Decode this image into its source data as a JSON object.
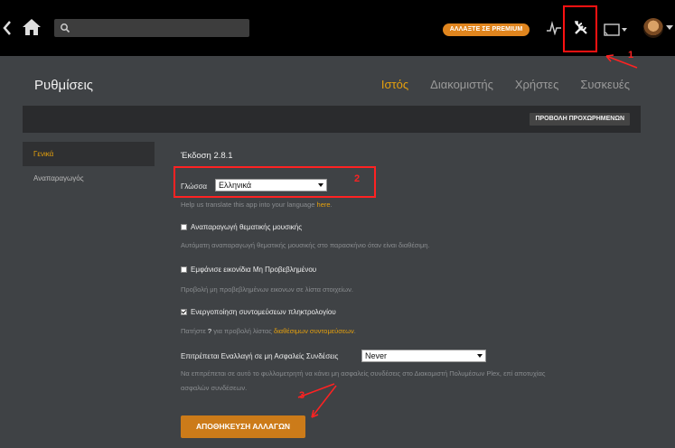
{
  "topbar": {
    "premium_label": "ΑΛΛΑΞΤΕ ΣΕ PREMIUM",
    "search_placeholder": ""
  },
  "annotations": {
    "a1": "1",
    "a2": "2",
    "a3": "3"
  },
  "header": {
    "title": "Ρυθμίσεις",
    "tabs": [
      {
        "label": "Ιστός",
        "active": true
      },
      {
        "label": "Διακομιστής",
        "active": false
      },
      {
        "label": "Χρήστες",
        "active": false
      },
      {
        "label": "Συσκευές",
        "active": false
      }
    ],
    "advanced_label": "ΠΡΟΒΟΛΗ ΠΡΟΧΩΡΗΜΕΝΩΝ"
  },
  "sidebar": {
    "items": [
      {
        "label": "Γενικά",
        "active": true
      },
      {
        "label": "Αναπαραγωγός",
        "active": false
      }
    ]
  },
  "main": {
    "version": "Έκδοση 2.8.1",
    "language": {
      "label": "Γλώσσα",
      "value": "Ελληνικά",
      "help_text": "Help us translate this app into your language",
      "help_link": "here",
      "help_end": "."
    },
    "theme_music": {
      "label": "Αναπαραγωγή θεματικής μουσικής",
      "checked": false,
      "help": "Αυτόματη αναπαραγωγή θεματικής μουσικής στο παρασκήνιο όταν είναι διαθέσιμη."
    },
    "unwatched": {
      "label": "Εμφάνισε εικονίδια Μη Προβεβλημένου",
      "checked": false,
      "help": "Προβολή μη προβεβλημένων εικονων σε λίστα στοιχείων."
    },
    "shortcuts": {
      "label": "Ενεργοποίηση συντομεύσεων πληκτρολογίου",
      "checked": true,
      "help_pre": "Πατήστε",
      "help_key": "?",
      "help_mid": "για προβολή λίστας",
      "help_link": "διαθέσιμων συντομεύσεων",
      "help_end": "."
    },
    "insecure": {
      "label": "Επιτρέπεται Εναλλαγή σε μη Ασφαλείς Συνδέσεις",
      "value": "Never",
      "help_line1": "Να επιτρέπεται σε αυτό το φυλλομετρητή να κάνει μη ασφαλείς συνδέσεις στο Διακομιστή Πολυμέσων Plex, επί αποτυχίας",
      "help_line2": "ασφαλών συνδέσεων."
    },
    "save_label": "ΑΠΟΘΗΚΕΥΣΗ ΑΛΛΑΓΩΝ"
  }
}
